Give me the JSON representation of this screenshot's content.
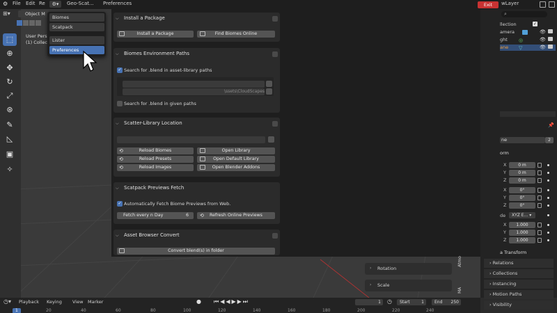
{
  "topbar": {
    "menus": [
      "File",
      "Edit",
      "Re"
    ],
    "addon_name": "Geo-Scat...",
    "tab_label": "Preferences",
    "exit_label": "Exit",
    "layer_name": "wLayer"
  },
  "viewport": {
    "mode": "Object M",
    "user_persp": "User Pers",
    "collection": "(1) Collec"
  },
  "dropdown": {
    "items": [
      "Biomes",
      "Scatpack",
      "Lister",
      "Preferences"
    ],
    "selected": "Preferences"
  },
  "install": {
    "title": "Install a Package",
    "install_btn": "Install a Package",
    "find_btn": "Find Biomes Online"
  },
  "env_paths": {
    "title": "Biomes Environment Paths",
    "search_asset": "Search for .blend in asset-library paths",
    "path_suffix": "\\ssets\\CloudScapes",
    "search_given": "Search for .blend in given paths"
  },
  "scatter_lib": {
    "title": "Scatter-Library Location",
    "reload_biomes": "Reload Biomes",
    "open_library": "Open Library",
    "reload_presets": "Reload Presets",
    "open_default": "Open Default Library",
    "reload_images": "Reload Images",
    "open_blender": "Open Blender Addons"
  },
  "previews": {
    "title": "Scatpack Previews Fetch",
    "auto_fetch": "Automatically Fetch Biome Previews from Web.",
    "fetch_label": "Fetch every n Day",
    "fetch_value": "6",
    "refresh_btn": "Refresh Online Previews"
  },
  "asset_convert": {
    "title": "Asset Browser Convert",
    "convert_btn": "Convert blend(s) in folder"
  },
  "outliner": {
    "rows": [
      "llection",
      "amera",
      "ght",
      "ane"
    ]
  },
  "properties": {
    "name_field": "ne",
    "name_count": "2",
    "transform_label": "orm",
    "loc_x": "0 m",
    "loc_y": "0 m",
    "loc_z": "0 m",
    "rot_x": "0°",
    "rot_y": "0°",
    "rot_z": "0°",
    "rot_mode_label": "de",
    "rot_mode": "XYZ E...",
    "scale_x": "1.000",
    "scale_y": "1.000",
    "scale_z": "1.000",
    "delta_transform": "a Transform",
    "sections": [
      "Relations",
      "Collections",
      "Instancing",
      "Motion Paths",
      "Visibility"
    ]
  },
  "npanel": {
    "rotation": "Rotation",
    "scale": "Scale",
    "side_tabs": [
      "Atmo",
      "MA"
    ]
  },
  "timeline": {
    "menus": [
      "Playback",
      "Keying",
      "View",
      "Marker"
    ],
    "current_frame": "1",
    "start_label": "Start",
    "start_value": "1",
    "end_label": "End",
    "end_value": "250",
    "ruler": [
      "1",
      "20",
      "40",
      "60",
      "80",
      "100",
      "120",
      "140",
      "160",
      "180",
      "200",
      "220",
      "240"
    ]
  },
  "colors": {
    "accent": "#4772b3",
    "exit": "#c83232"
  }
}
